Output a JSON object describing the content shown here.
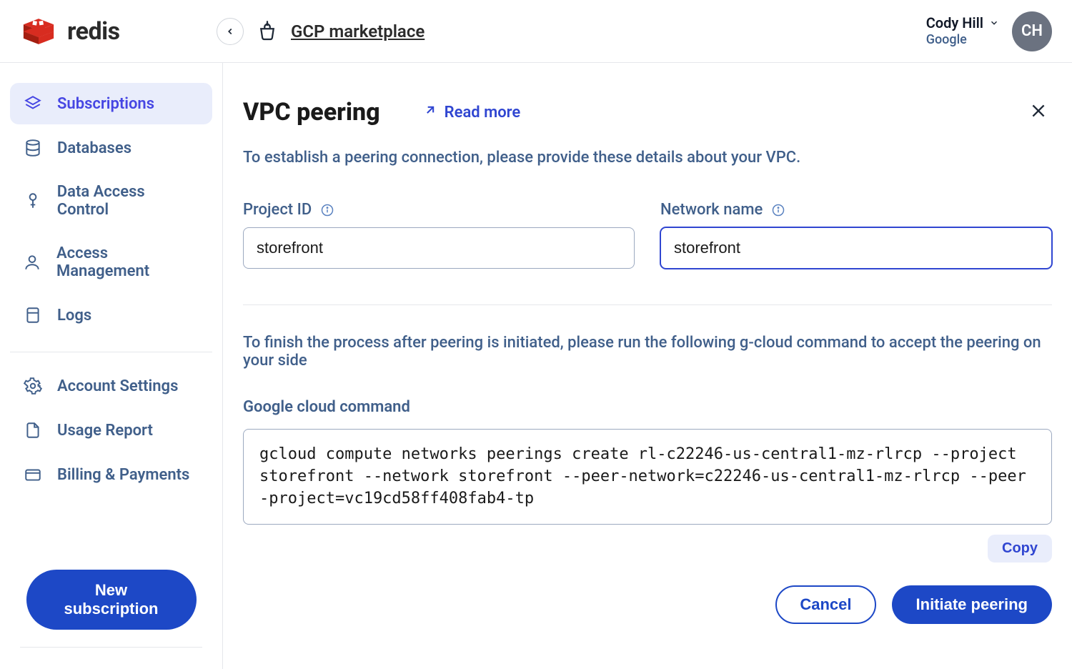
{
  "brand": {
    "name": "redis"
  },
  "header": {
    "breadcrumb_label": "GCP marketplace",
    "user_name": "Cody Hill",
    "user_sub": "Google",
    "avatar_initials": "CH"
  },
  "sidebar": {
    "items": [
      {
        "label": "Subscriptions",
        "icon": "subscriptions",
        "active": true
      },
      {
        "label": "Databases",
        "icon": "databases"
      },
      {
        "label": "Data Access Control",
        "icon": "key"
      },
      {
        "label": "Access Management",
        "icon": "user"
      },
      {
        "label": "Logs",
        "icon": "logs"
      }
    ],
    "items2": [
      {
        "label": "Account Settings",
        "icon": "gear"
      },
      {
        "label": "Usage Report",
        "icon": "report"
      },
      {
        "label": "Billing & Payments",
        "icon": "card"
      }
    ],
    "new_subscription_label": "New subscription"
  },
  "main": {
    "title": "VPC peering",
    "read_more_label": "Read more",
    "description": "To establish a peering connection, please provide these details about your VPC.",
    "project_id_label": "Project ID",
    "project_id_value": "storefront",
    "network_name_label": "Network name",
    "network_name_value": "storefront",
    "finish_text": "To finish the process after peering is initiated, please run the following g-cloud command to accept the peering on your side",
    "command_label": "Google cloud command",
    "command_text": "gcloud compute networks peerings create rl-c22246-us-central1-mz-rlrcp --project storefront --network storefront --peer-network=c22246-us-central1-mz-rlrcp --peer-project=vc19cd58ff408fab4-tp",
    "copy_label": "Copy",
    "cancel_label": "Cancel",
    "initiate_label": "Initiate peering"
  }
}
